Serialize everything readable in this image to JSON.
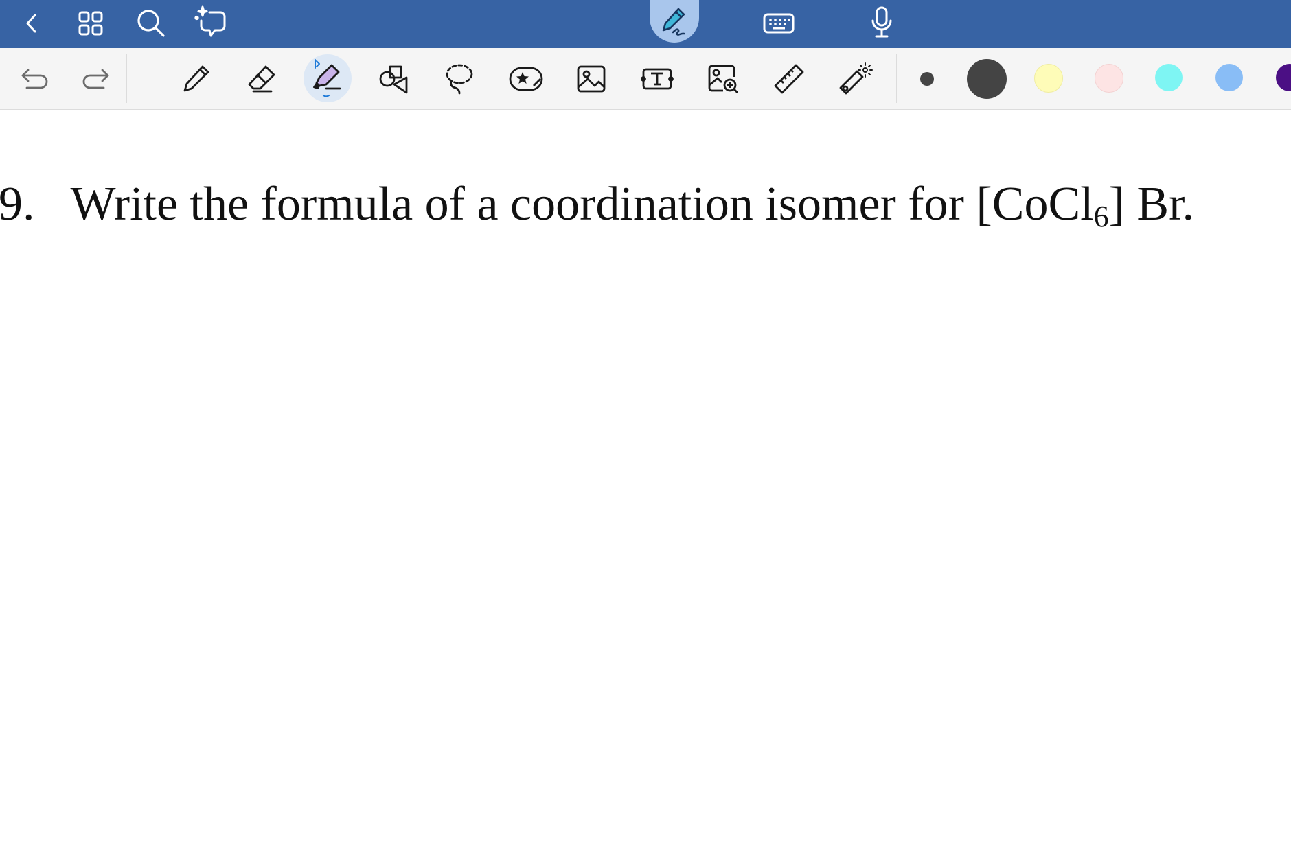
{
  "colors": {
    "topbar": "#3763a4",
    "toolbar": "#f5f5f5",
    "selected_tool_bg": "#dde8f5",
    "mode_pen_bg": "#a9c6ec",
    "swatches": [
      "#444444",
      "#444444",
      "#fefcb8",
      "#fde4e4",
      "#7ef5f3",
      "#89bdf6",
      "#4b0f84"
    ]
  },
  "topbar": {
    "icons": [
      "back-icon",
      "grid-icon",
      "search-icon",
      "ai-chat-icon",
      "pen-mode-icon",
      "keyboard-icon",
      "microphone-icon"
    ]
  },
  "toolbar": {
    "tools": [
      "undo-icon",
      "redo-icon",
      "pen-icon",
      "eraser-icon",
      "highlighter-icon",
      "shapes-icon",
      "lasso-icon",
      "sticker-icon",
      "image-icon",
      "text-box-icon",
      "image-search-icon",
      "ruler-icon",
      "laser-pointer-icon"
    ],
    "selected_tool": "highlighter-icon",
    "stroke_sizes": [
      "small",
      "large"
    ]
  },
  "document": {
    "question_number": "9.",
    "question_text": "Write the formula of a coordination isomer for [CoCl",
    "subscript": "6",
    "question_tail": "] Br."
  }
}
